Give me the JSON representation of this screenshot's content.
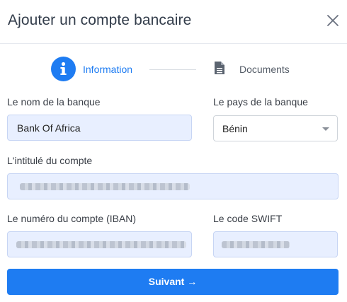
{
  "dialog": {
    "title": "Ajouter un compte bancaire"
  },
  "steps": [
    {
      "label": "Information",
      "active": true,
      "icon": "info-icon"
    },
    {
      "label": "Documents",
      "active": false,
      "icon": "document-icon"
    }
  ],
  "form": {
    "bank_name": {
      "label": "Le nom de la banque",
      "value": "Bank Of Africa"
    },
    "bank_country": {
      "label": "Le pays de la banque",
      "value": "Bénin"
    },
    "account_title": {
      "label": "L'intitulé du compte",
      "value": ""
    },
    "iban": {
      "label": "Le numéro du compte (IBAN)",
      "value": ""
    },
    "swift": {
      "label": "Le code SWIFT",
      "value": ""
    }
  },
  "actions": {
    "next_label": "Suivant",
    "next_arrow": "→"
  },
  "colors": {
    "accent": "#1e7cf2",
    "field_bg": "#e8efff"
  }
}
